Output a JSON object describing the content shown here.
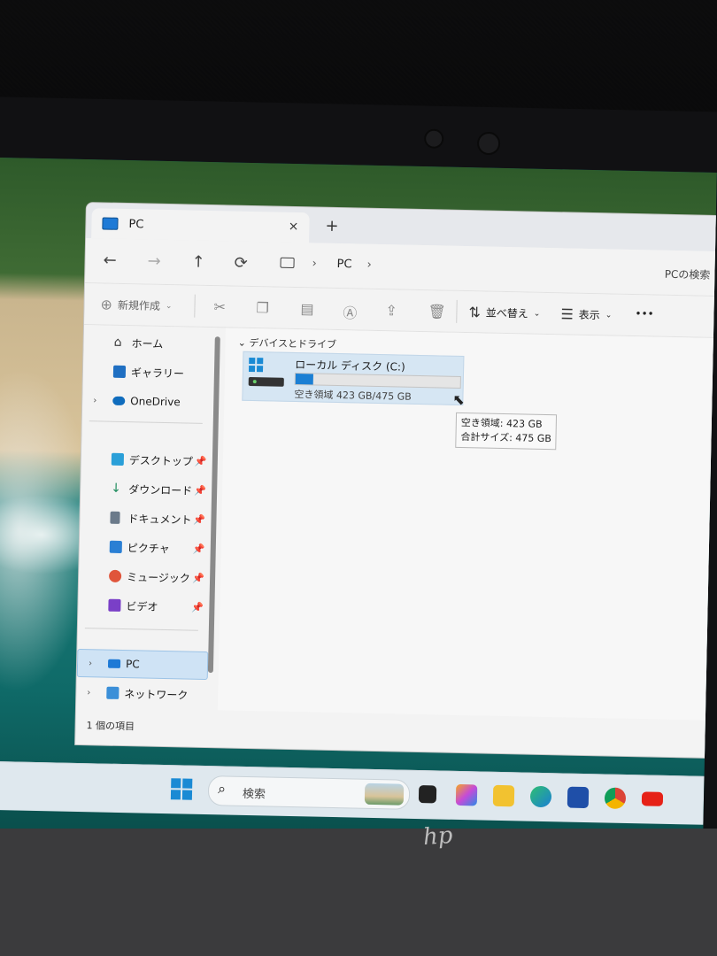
{
  "window": {
    "tab_title": "PC",
    "new_tab": "+",
    "close": "×"
  },
  "nav": {
    "back": "←",
    "forward": "→",
    "up": "↑",
    "refresh": "⟳",
    "breadcrumb": [
      "PC"
    ],
    "search_placeholder": "PCの検索"
  },
  "commandbar": {
    "new": "新規作成",
    "sort": "並べ替え",
    "view": "表示",
    "more": "•••"
  },
  "sidebar": {
    "items": [
      {
        "label": "ホーム",
        "icon": "home-icon"
      },
      {
        "label": "ギャラリー",
        "icon": "gallery-icon"
      },
      {
        "label": "OneDrive",
        "icon": "cloud-icon"
      },
      {
        "label": "デスクトップ",
        "icon": "desktop-icon",
        "pinned": true
      },
      {
        "label": "ダウンロード",
        "icon": "download-icon",
        "pinned": true
      },
      {
        "label": "ドキュメント",
        "icon": "document-icon",
        "pinned": true
      },
      {
        "label": "ピクチャ",
        "icon": "pictures-icon",
        "pinned": true
      },
      {
        "label": "ミュージック",
        "icon": "music-icon",
        "pinned": true
      },
      {
        "label": "ビデオ",
        "icon": "video-icon",
        "pinned": true
      },
      {
        "label": "PC",
        "icon": "pc-icon",
        "selected": true
      },
      {
        "label": "ネットワーク",
        "icon": "network-icon"
      }
    ]
  },
  "content": {
    "section_title": "デバイスとドライブ",
    "drive": {
      "name": "ローカル ディスク (C:)",
      "space_text": "空き領域 423 GB/475 GB",
      "used_fraction": 0.11
    },
    "tooltip": {
      "free": "空き領域: 423 GB",
      "total": "合計サイズ: 475 GB"
    }
  },
  "status": {
    "count": "1 個の項目"
  },
  "taskbar": {
    "search_placeholder": "検索"
  },
  "colors": {
    "accent": "#1a7fd4",
    "selection": "#cfe3f5"
  }
}
